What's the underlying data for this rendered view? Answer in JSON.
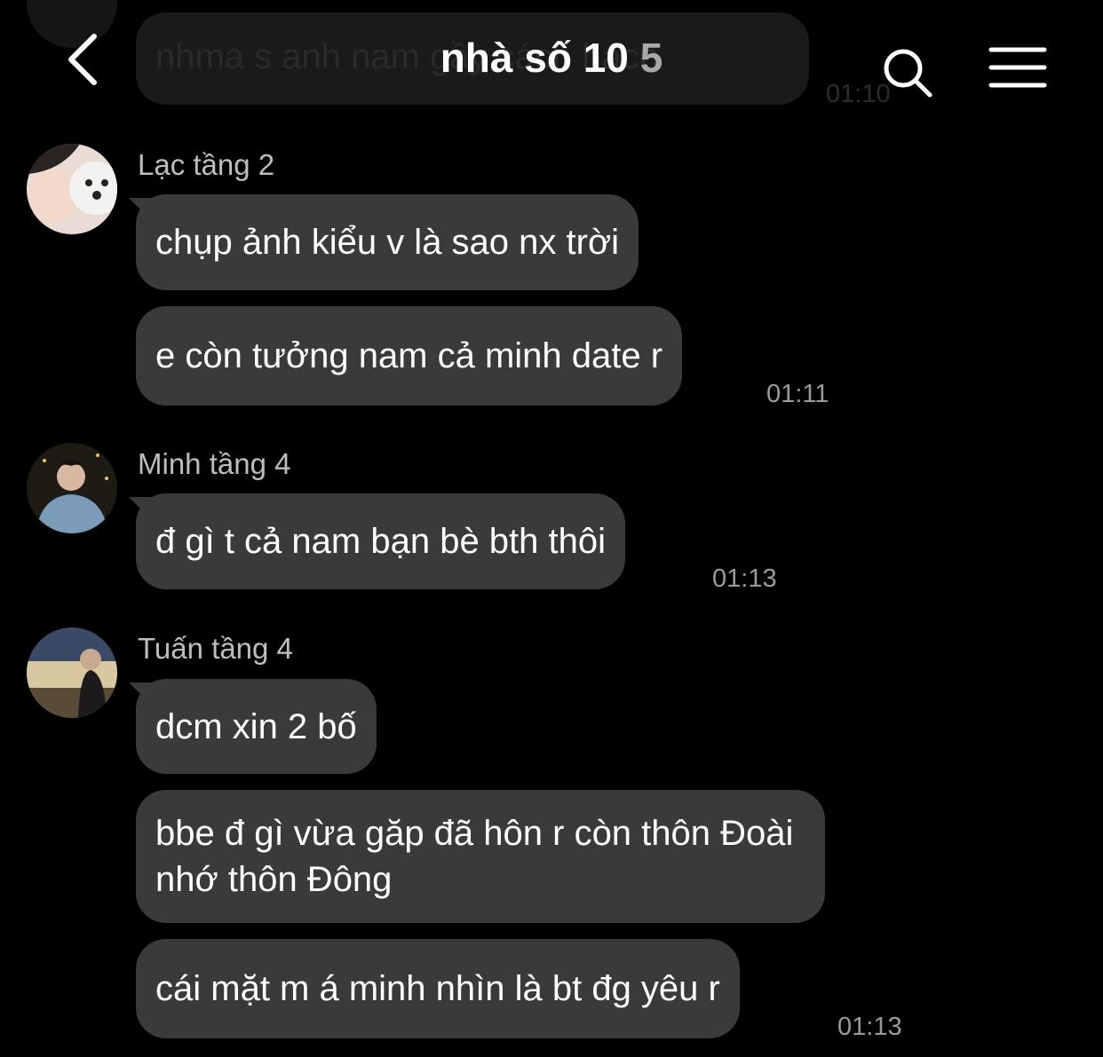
{
  "header": {
    "back_label": "<",
    "title": "nhà số 10",
    "member_count": "5",
    "search_icon": "search-icon",
    "menu_icon": "menu-icon"
  },
  "faded_message": {
    "text": "nhma s anh nam gầy cách hách",
    "time": "01:10"
  },
  "groups": [
    {
      "sender": "Lạc tầng 2",
      "messages": [
        "chụp ảnh kiểu v là sao nx trời",
        "e còn tưởng nam cả minh date r"
      ],
      "time": "01:11"
    },
    {
      "sender": "Minh tầng 4",
      "messages": [
        "đ gì t cả nam bạn bè bth thôi"
      ],
      "time": "01:13"
    },
    {
      "sender": "Tuấn tầng 4",
      "messages": [
        "dcm xin 2 bố",
        "bbe đ gì vừa găp đã hôn r còn thôn Đoài nhớ thôn Đông",
        "cái mặt m á minh nhìn là bt đg yêu r"
      ],
      "time": "01:13"
    }
  ],
  "colors": {
    "background": "#000000",
    "bubble": "#3a3a3c",
    "text": "#ffffff",
    "secondary_text": "#bdbdbd",
    "timestamp": "#9a9a9a"
  }
}
